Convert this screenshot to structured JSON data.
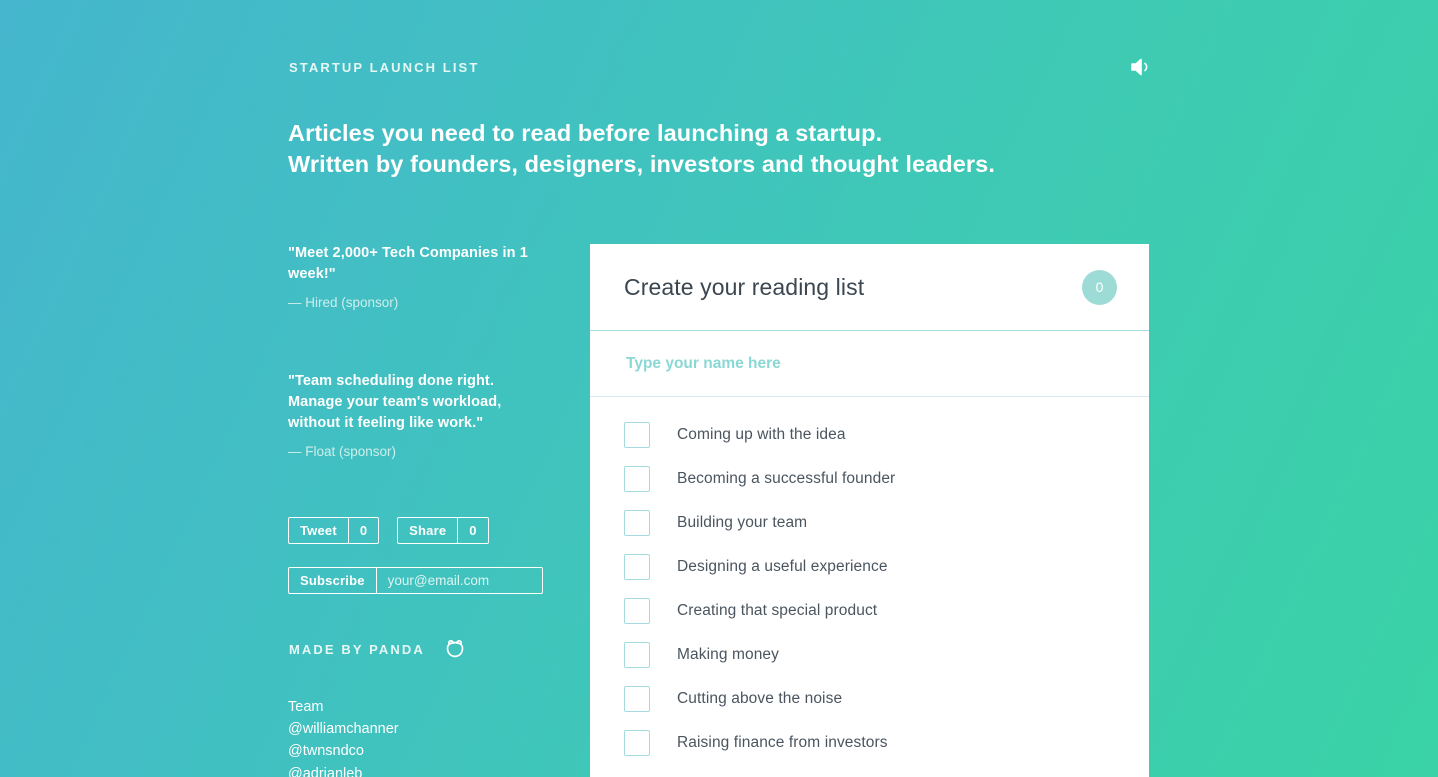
{
  "header": {
    "eyebrow": "STARTUP LAUNCH LIST",
    "sound_icon": "speaker-icon",
    "headline_line1": "Articles you need to read before launching a startup.",
    "headline_line2": "Written by founders, designers, investors and thought leaders."
  },
  "sidebar": {
    "sponsors": [
      {
        "quote": "\"Meet 2,000+ Tech Companies in 1 week!\"",
        "by": "— Hired (sponsor)"
      },
      {
        "quote": "\"Team scheduling done right. Manage your team's workload, without it feeling like work.\"",
        "by": "— Float (sponsor)"
      }
    ],
    "social": [
      {
        "label": "Tweet",
        "count": "0"
      },
      {
        "label": "Share",
        "count": "0"
      }
    ],
    "subscribe": {
      "button_label": "Subscribe",
      "placeholder": "your@email.com",
      "value": ""
    },
    "made_by": {
      "label": "MADE BY PANDA",
      "icon": "panda-icon"
    },
    "team": {
      "heading": "Team",
      "handles": [
        "@williamchanner",
        "@twnsndco",
        "@adrianleb"
      ]
    }
  },
  "card": {
    "title": "Create your reading list",
    "count": "0",
    "name_input": {
      "placeholder": "Type your name here",
      "value": ""
    },
    "items": [
      {
        "label": "Coming up with the idea",
        "checked": false
      },
      {
        "label": "Becoming a successful founder",
        "checked": false
      },
      {
        "label": "Building your team",
        "checked": false
      },
      {
        "label": "Designing a useful experience",
        "checked": false
      },
      {
        "label": "Creating that special product",
        "checked": false
      },
      {
        "label": "Making money",
        "checked": false
      },
      {
        "label": "Cutting above the noise",
        "checked": false
      },
      {
        "label": "Raising finance from investors",
        "checked": false
      }
    ]
  },
  "colors": {
    "gradient_start": "#45b6cd",
    "gradient_end": "#3ad2a6",
    "badge": "#9ddbd7",
    "checkbox_border": "#a5dbde",
    "text_dark": "#4b555f"
  }
}
